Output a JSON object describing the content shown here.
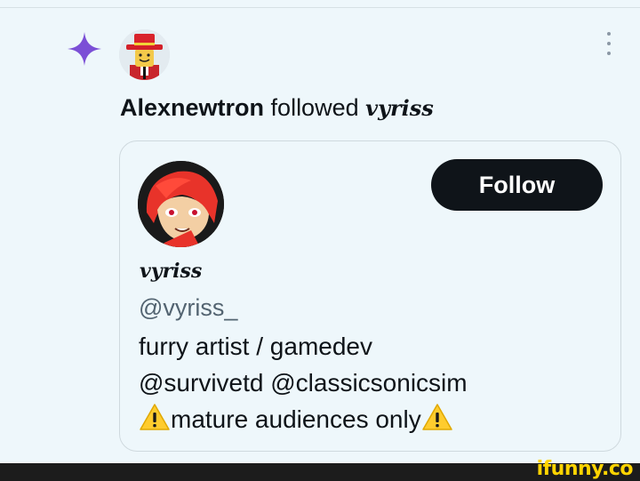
{
  "activity": {
    "actor": "Alexnewtron",
    "verb": "followed",
    "target": "vyriss"
  },
  "profile_card": {
    "display_name": "vyriss",
    "handle": "@vyriss_",
    "bio_lines": [
      "furry artist / gamedev",
      "@survivetd @classicsonicsim",
      "mature audiences only"
    ],
    "follow_label": "Follow"
  },
  "icons": {
    "sparkle": "sparkle-icon",
    "more": "more-vertical-icon",
    "warning": "warning-icon"
  },
  "colors": {
    "background": "#eef7fb",
    "sparkle": "#7b4fd6",
    "follow_button": "#0f1419",
    "handle": "#536471",
    "warning": "#ffcc2e"
  },
  "watermark": "ifunny.co"
}
